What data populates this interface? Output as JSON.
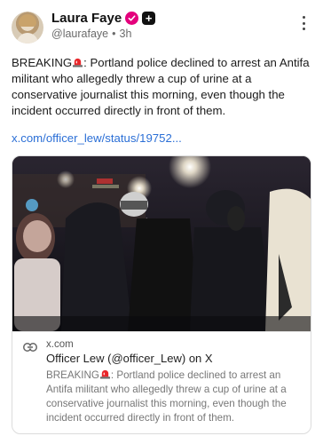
{
  "post": {
    "author_name": "Laura Faye",
    "handle": "@laurafaye",
    "separator": "•",
    "time": "3h",
    "text_before": "BREAKING",
    "text_after": ": Portland police declined to arrest an Antifa militant who allegedly threw a cup of urine at a conservative journalist this morning, even though the incident occurred directly in front of them.",
    "link_text": "x.com/officer_lew/status/19752..."
  },
  "card": {
    "domain": "x.com",
    "title": "Officer Lew (@officer_Lew) on X",
    "desc_before": "BREAKING",
    "desc_after": ": Portland police declined to arrest an Antifa militant who allegedly threw a cup of urine at a conservative journalist this morning, even though the incident occurred directly in front of them."
  },
  "icons": {
    "verified": "verified-badge-icon",
    "plus": "plus-badge-icon",
    "more": "more-options-icon",
    "siren": "rotating-light-emoji",
    "link": "link-chain-icon"
  },
  "colors": {
    "link": "#2b6fd6",
    "verified": "#e4007c",
    "muted": "#6b6b6b"
  }
}
